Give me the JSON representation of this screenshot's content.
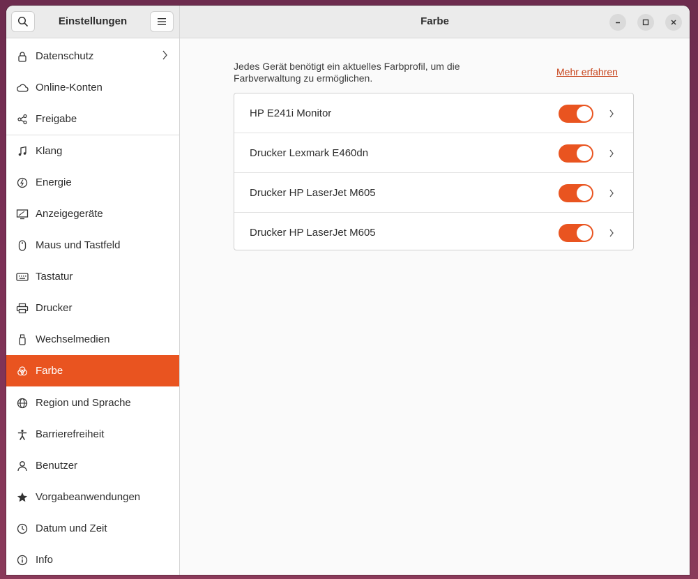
{
  "sidebar_header": {
    "title": "Einstellungen"
  },
  "header": {
    "title": "Farbe"
  },
  "sidebar": {
    "items": [
      {
        "label": "Datenschutz",
        "icon": "lock-icon"
      },
      {
        "label": "Online-Konten",
        "icon": "cloud-icon"
      },
      {
        "label": "Freigabe",
        "icon": "share-icon"
      },
      {
        "label": "Klang",
        "icon": "music-note-icon"
      },
      {
        "label": "Energie",
        "icon": "power-icon"
      },
      {
        "label": "Anzeigegeräte",
        "icon": "display-icon"
      },
      {
        "label": "Maus und Tastfeld",
        "icon": "mouse-icon"
      },
      {
        "label": "Tastatur",
        "icon": "keyboard-icon"
      },
      {
        "label": "Drucker",
        "icon": "printer-icon"
      },
      {
        "label": "Wechselmedien",
        "icon": "usb-drive-icon"
      },
      {
        "label": "Farbe",
        "icon": "color-icon"
      },
      {
        "label": "Region und Sprache",
        "icon": "globe-icon"
      },
      {
        "label": "Barrierefreiheit",
        "icon": "accessibility-icon"
      },
      {
        "label": "Benutzer",
        "icon": "user-icon"
      },
      {
        "label": "Vorgabeanwendungen",
        "icon": "star-icon"
      },
      {
        "label": "Datum und Zeit",
        "icon": "clock-icon"
      },
      {
        "label": "Info",
        "icon": "info-icon"
      }
    ],
    "active": "Farbe"
  },
  "main": {
    "description": "Jedes Gerät benötigt ein aktuelles Farbprofil, um die Farbverwaltung zu ermöglichen.",
    "learn_more": "Mehr erfahren",
    "devices": [
      {
        "name": "HP E241i Monitor",
        "enabled": true
      },
      {
        "name": "Drucker Lexmark E460dn",
        "enabled": true
      },
      {
        "name": "Drucker HP LaserJet M605",
        "enabled": true
      },
      {
        "name": "Drucker HP LaserJet M605",
        "enabled": true
      }
    ]
  },
  "colors": {
    "accent": "#e95420",
    "link": "#c7431a"
  }
}
